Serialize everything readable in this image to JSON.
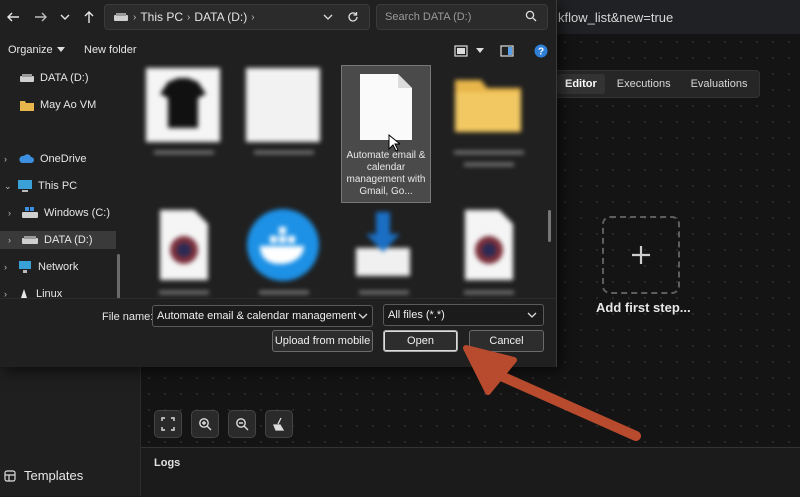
{
  "background_app": {
    "url": "kflow_list&new=true",
    "tabs": [
      {
        "label": "Editor",
        "active": true
      },
      {
        "label": "Executions",
        "active": false
      },
      {
        "label": "Evaluations",
        "active": false
      }
    ],
    "add_first_step": "Add first step...",
    "logs": "Logs",
    "templates": "Templates"
  },
  "dialog": {
    "breadcrumb": [
      "This PC",
      "DATA (D:)"
    ],
    "search_placeholder": "Search DATA (D:)",
    "toolbar": {
      "organize": "Organize",
      "new_folder": "New folder"
    },
    "nav": {
      "quick": [
        {
          "label": "DATA (D:)",
          "icon": "drive-icon"
        },
        {
          "label": "May Ao VM",
          "icon": "folder-icon"
        }
      ],
      "tree": [
        {
          "label": "OneDrive",
          "icon": "cloud-icon"
        },
        {
          "label": "This PC",
          "icon": "computer-icon"
        },
        {
          "label": "Windows (C:)",
          "icon": "windows-drive-icon"
        },
        {
          "label": "DATA (D:)",
          "icon": "drive-icon"
        },
        {
          "label": "Network",
          "icon": "network-icon"
        },
        {
          "label": "Linux",
          "icon": "linux-icon"
        }
      ]
    },
    "selected_file_label": "Automate email & calendar management with Gmail, Go...",
    "file_name_label": "File name:",
    "file_name_value": "Automate email & calendar management wit",
    "file_type": "All files (*.*)",
    "buttons": {
      "upload": "Upload from mobile",
      "open": "Open",
      "cancel": "Cancel"
    }
  },
  "colors": {
    "arrow": "#b84a2e",
    "help_icon": "#2f7fd6",
    "folder": "#e8b64a"
  }
}
